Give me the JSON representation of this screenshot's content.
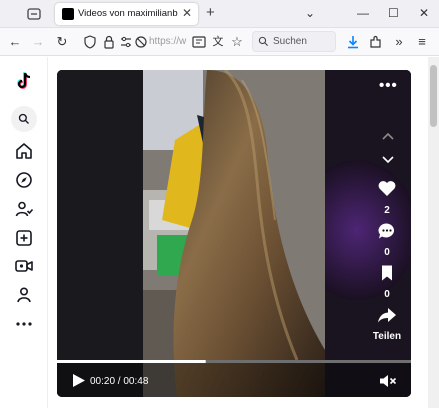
{
  "browser": {
    "tab_title": "Videos von maximilianbaehring",
    "url_text": "https://w",
    "search_placeholder": "Suchen"
  },
  "player": {
    "time_display": "00:20 / 00:48",
    "progress": 0.42,
    "likes": "2",
    "comments": "0",
    "saves": "0",
    "share_label": "Teilen"
  },
  "colors": {
    "accent": "#0a84ff",
    "tiktok_red": "#fe2c55",
    "tiktok_cyan": "#25f4ee"
  }
}
